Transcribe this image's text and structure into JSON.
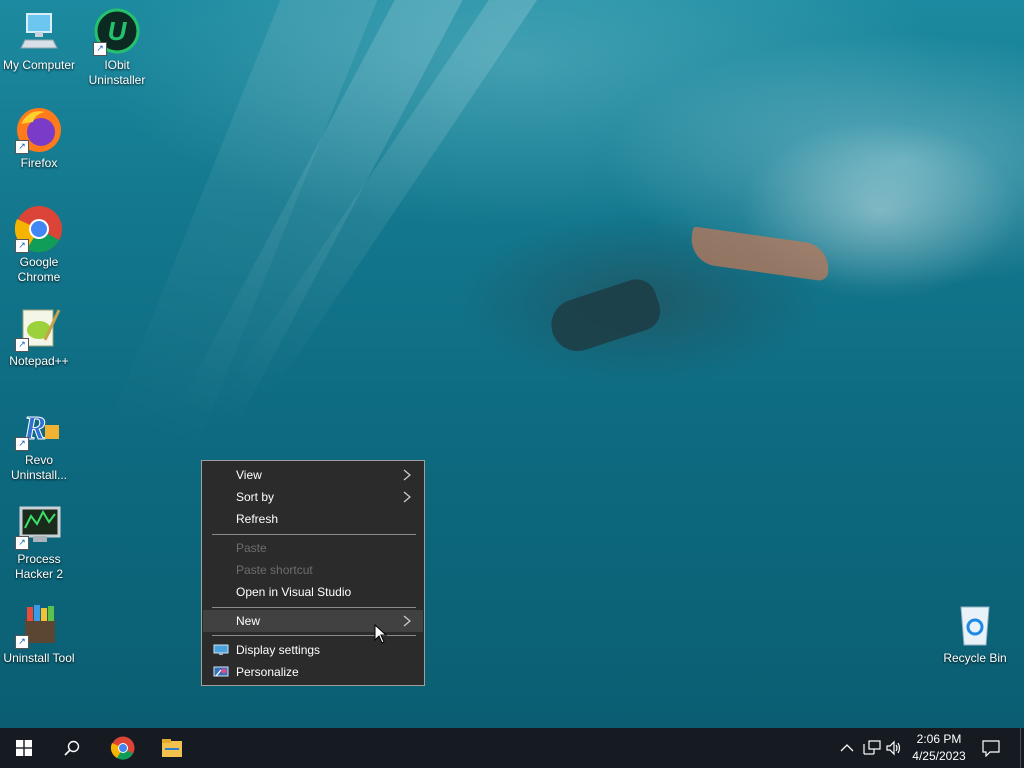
{
  "desktop": {
    "icons": [
      {
        "label_1": "My Computer",
        "label_2": ""
      },
      {
        "label_1": "IObit",
        "label_2": "Uninstaller"
      },
      {
        "label_1": "Firefox",
        "label_2": ""
      },
      {
        "label_1": "Google",
        "label_2": "Chrome"
      },
      {
        "label_1": "Notepad++",
        "label_2": ""
      },
      {
        "label_1": "Revo",
        "label_2": "Uninstall..."
      },
      {
        "label_1": "Process",
        "label_2": "Hacker 2"
      },
      {
        "label_1": "Uninstall Tool",
        "label_2": ""
      },
      {
        "label_1": "Recycle Bin",
        "label_2": ""
      }
    ]
  },
  "context_menu": {
    "items": [
      {
        "label": "View",
        "state": "enabled",
        "submenu": true
      },
      {
        "label": "Sort by",
        "state": "enabled",
        "submenu": true
      },
      {
        "label": "Refresh",
        "state": "enabled",
        "submenu": false
      },
      {
        "label": "Paste",
        "state": "disabled",
        "submenu": false
      },
      {
        "label": "Paste shortcut",
        "state": "disabled",
        "submenu": false
      },
      {
        "label": "Open in Visual Studio",
        "state": "enabled",
        "submenu": false
      },
      {
        "label": "New",
        "state": "hovered",
        "submenu": true
      },
      {
        "label": "Display settings",
        "state": "enabled",
        "icon": "monitor-icon"
      },
      {
        "label": "Personalize",
        "state": "enabled",
        "icon": "personalize-icon"
      }
    ]
  },
  "taskbar": {
    "pinned": [
      "start-icon",
      "search-icon",
      "chrome-icon",
      "file-explorer-icon"
    ],
    "tray": {
      "time": "2:06 PM",
      "date": "4/25/2023",
      "icons": [
        "chevron-up-icon",
        "network-icon",
        "volume-icon",
        "notification-icon"
      ]
    }
  },
  "colors": {
    "taskbar": "#161b22",
    "menu_bg": "#2b2b2b",
    "menu_hover": "#414141",
    "menu_disabled_text": "#6d6d6d"
  }
}
